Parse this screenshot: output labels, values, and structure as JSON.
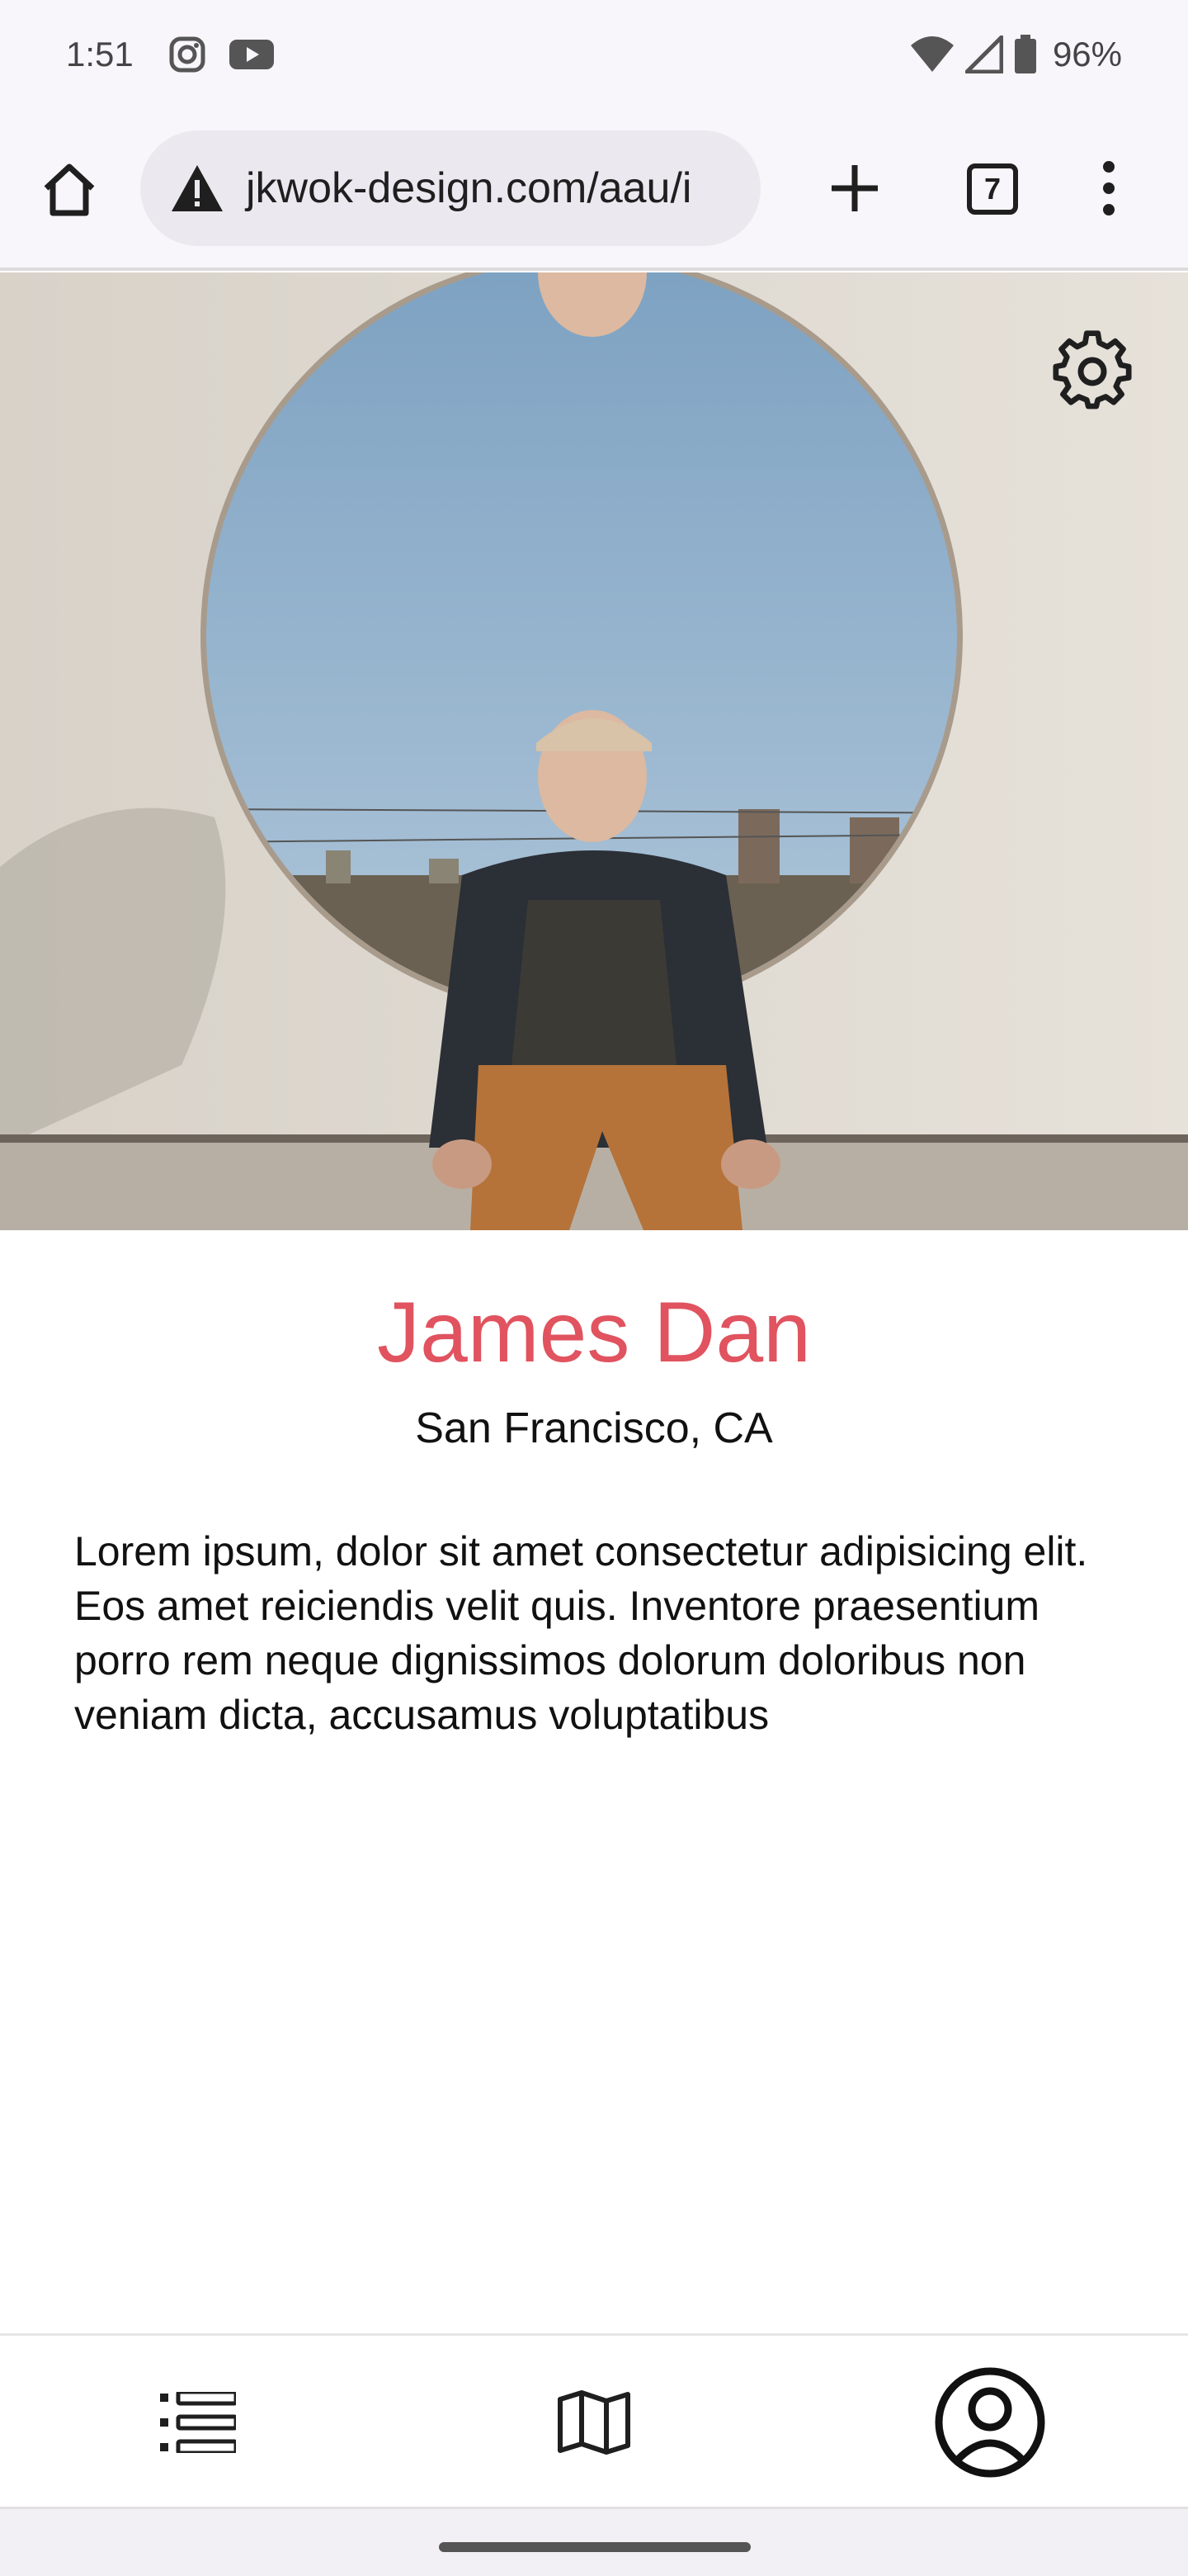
{
  "status_bar": {
    "time": "1:51",
    "battery": "96%",
    "notification_icons": [
      "instagram-icon",
      "youtube-icon"
    ],
    "system_icons": [
      "wifi-icon",
      "cell-signal-icon",
      "battery-icon"
    ]
  },
  "browser": {
    "url": "jkwok-design.com/aau/i",
    "tab_count": "7",
    "icons": [
      "home-icon",
      "warning-icon",
      "plus-icon",
      "tab-switcher-icon",
      "more-vert-icon"
    ]
  },
  "profile": {
    "name": "James Dan",
    "location": "San Francisco, CA",
    "bio": "Lorem ipsum, dolor sit amet consectetur adipisicing elit. Eos amet reiciendis velit quis. Inventore praesentium porro rem neque dignissimos dolorum doloribus non veniam dicta, accusamus voluptatibus"
  },
  "hero": {
    "settings_icon": "gear-icon"
  },
  "bottom_nav": {
    "items": [
      {
        "icon": "list-icon",
        "active": false
      },
      {
        "icon": "map-icon",
        "active": false
      },
      {
        "icon": "account-circle-icon",
        "active": true
      }
    ]
  },
  "colors": {
    "accent": "#e0535f",
    "chrome_bg": "#f8f6fb",
    "url_bg": "#ebe9ef"
  }
}
